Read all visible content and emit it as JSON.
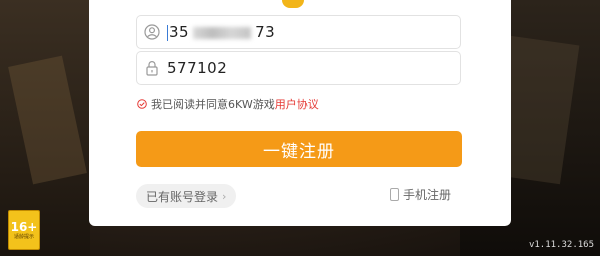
{
  "form": {
    "account": {
      "prefix": "35",
      "suffix": "73"
    },
    "password": {
      "value": "577102"
    },
    "agreement": {
      "text": "我已阅读并同意6KW游戏",
      "link": "用户协议"
    },
    "register_button": "一键注册",
    "login_link": "已有账号登录",
    "phone_register": "手机注册"
  },
  "badge": {
    "age": "16+",
    "caption": "适龄提示"
  },
  "version": "v1.11.32.165",
  "colors": {
    "accent": "#f59a17",
    "link": "#e53935"
  },
  "icons": {
    "account": "user-icon",
    "password": "lock-icon",
    "agree": "checkbox-icon",
    "phone": "phone-icon"
  }
}
